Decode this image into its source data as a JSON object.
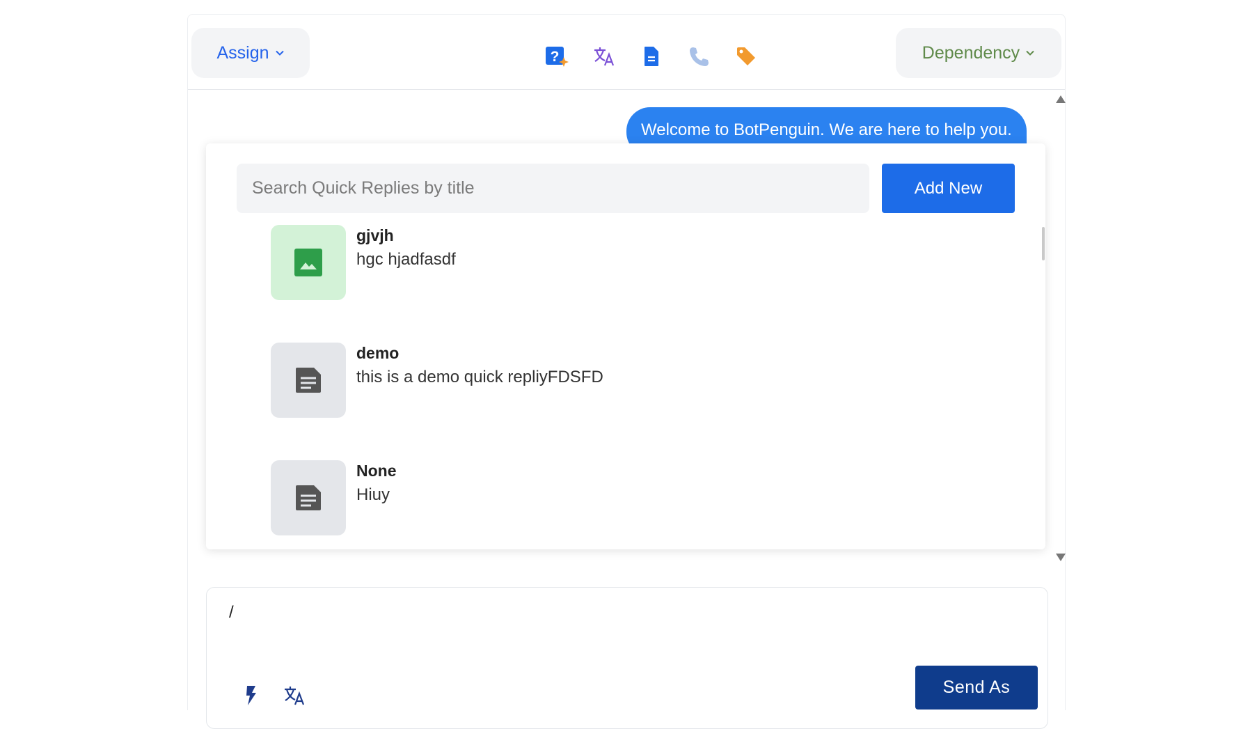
{
  "header": {
    "assign_label": "Assign",
    "dependency_label": "Dependency",
    "icons": [
      "help-ai-icon",
      "translate-icon",
      "document-icon",
      "phone-icon",
      "tag-icon"
    ]
  },
  "chat": {
    "bot_message": "Welcome to BotPenguin. We are here to help you."
  },
  "quick_replies": {
    "search_placeholder": "Search Quick Replies by title",
    "add_new_label": "Add New",
    "items": [
      {
        "title": "gjvjh",
        "description": "hgc hjadfasdf",
        "type": "image"
      },
      {
        "title": "demo",
        "description": "this is a demo quick repliyFDSFD",
        "type": "document"
      },
      {
        "title": "None",
        "description": "Hiuy",
        "type": "document"
      }
    ]
  },
  "composer": {
    "text": "/",
    "send_label": "Send As",
    "icons": [
      "lightning-icon",
      "translate-icon"
    ]
  },
  "colors": {
    "primary_blue": "#1d6ce8",
    "bubble_blue": "#2b82f0",
    "send_navy": "#0f3c8c",
    "dependency_green": "#5f8a4a",
    "tag_orange": "#f29a2e"
  }
}
